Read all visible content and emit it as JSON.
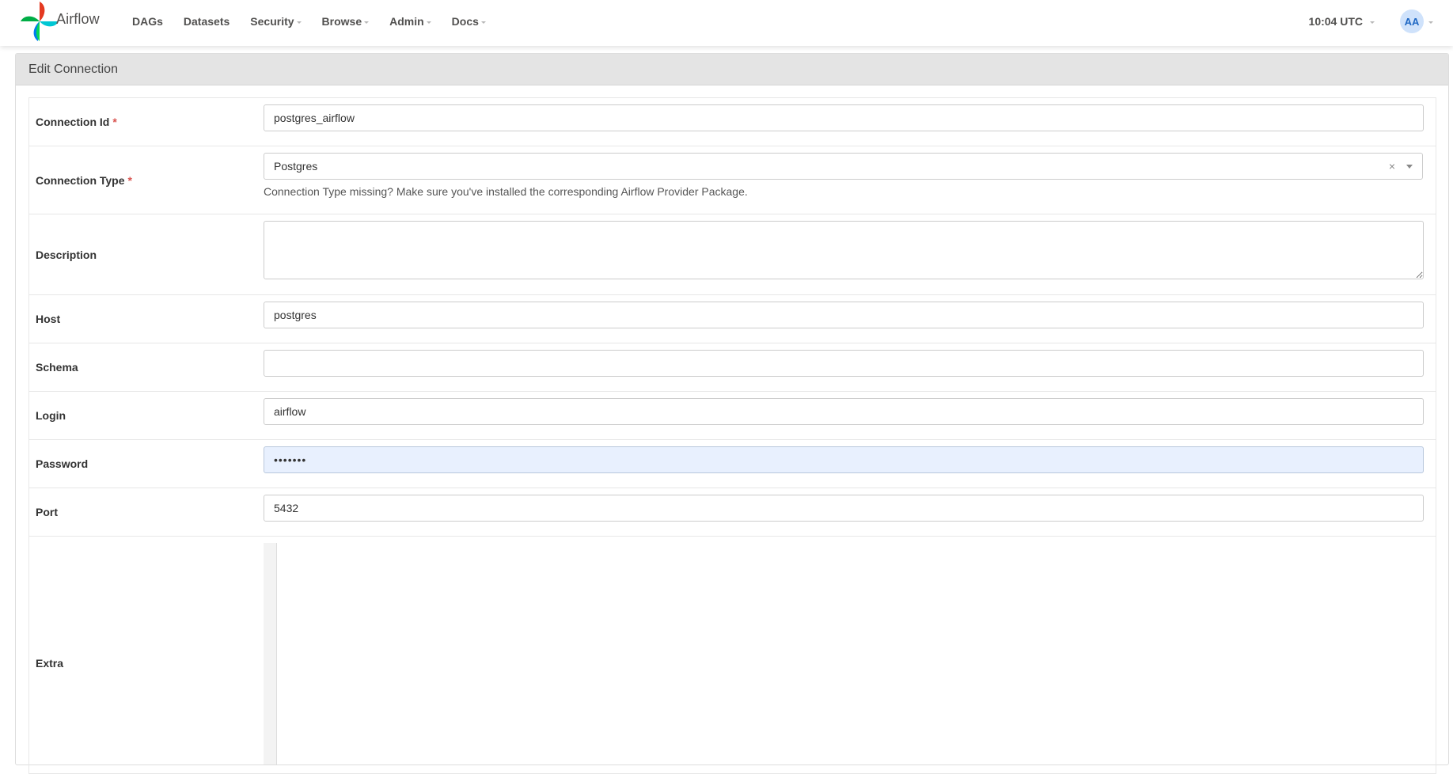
{
  "navbar": {
    "brand": "Airflow",
    "items": [
      {
        "label": "DAGs",
        "dropdown": false
      },
      {
        "label": "Datasets",
        "dropdown": false
      },
      {
        "label": "Security",
        "dropdown": true
      },
      {
        "label": "Browse",
        "dropdown": true
      },
      {
        "label": "Admin",
        "dropdown": true
      },
      {
        "label": "Docs",
        "dropdown": true
      }
    ],
    "clock": "10:04 UTC",
    "user_initials": "AA"
  },
  "colors": {
    "avatar_bg": "#cfe2fb",
    "avatar_text": "#1f68c4",
    "required": "#d9534f",
    "autofill_bg": "#e8f0fe"
  },
  "panel": {
    "title": "Edit Connection"
  },
  "form": {
    "connection_id": {
      "label": "Connection Id",
      "required": "*",
      "value": "postgres_airflow"
    },
    "connection_type": {
      "label": "Connection Type",
      "required": "*",
      "value": "Postgres",
      "clear": "×",
      "help": "Connection Type missing? Make sure you've installed the corresponding Airflow Provider Package."
    },
    "description": {
      "label": "Description",
      "value": ""
    },
    "host": {
      "label": "Host",
      "value": "postgres"
    },
    "schema": {
      "label": "Schema",
      "value": ""
    },
    "login": {
      "label": "Login",
      "value": "airflow"
    },
    "password": {
      "label": "Password",
      "value": "•••••••"
    },
    "port": {
      "label": "Port",
      "value": "5432"
    },
    "extra": {
      "label": "Extra",
      "value": ""
    }
  }
}
